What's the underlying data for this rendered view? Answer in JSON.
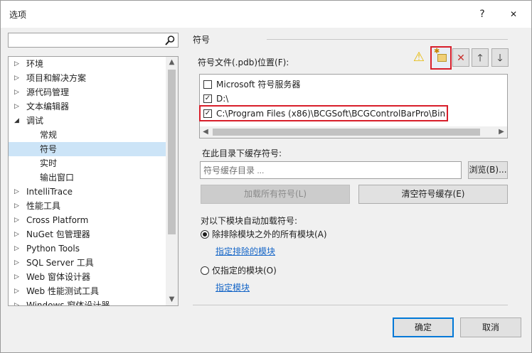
{
  "window": {
    "title": "选项",
    "help": "?",
    "close": "✕"
  },
  "search": {
    "value": "",
    "placeholder": ""
  },
  "tree": {
    "items": [
      {
        "label": "环境",
        "arrow": "▷"
      },
      {
        "label": "项目和解决方案",
        "arrow": "▷"
      },
      {
        "label": "源代码管理",
        "arrow": "▷"
      },
      {
        "label": "文本编辑器",
        "arrow": "▷"
      },
      {
        "label": "调试",
        "arrow": "◢"
      },
      {
        "label": "常规",
        "arrow": ""
      },
      {
        "label": "符号",
        "arrow": ""
      },
      {
        "label": "实时",
        "arrow": ""
      },
      {
        "label": "输出窗口",
        "arrow": ""
      },
      {
        "label": "IntelliTrace",
        "arrow": "▷"
      },
      {
        "label": "性能工具",
        "arrow": "▷"
      },
      {
        "label": "Cross Platform",
        "arrow": "▷"
      },
      {
        "label": "NuGet 包管理器",
        "arrow": "▷"
      },
      {
        "label": "Python Tools",
        "arrow": "▷"
      },
      {
        "label": "SQL Server 工具",
        "arrow": "▷"
      },
      {
        "label": "Web 窗体设计器",
        "arrow": "▷"
      },
      {
        "label": "Web 性能测试工具",
        "arrow": "▷"
      },
      {
        "label": "Windows 窗体设计器",
        "arrow": "▷"
      }
    ]
  },
  "symbols": {
    "section_title": "符号",
    "pdb_label": "符号文件(.pdb)位置(F):",
    "locations": [
      {
        "text": "Microsoft 符号服务器",
        "checked": ""
      },
      {
        "text": "D:\\",
        "checked": "✓"
      },
      {
        "text": "C:\\Program Files (x86)\\BCGSoft\\BCGControlBarPro\\Bin",
        "checked": "✓"
      }
    ],
    "cache_label": "在此目录下缓存符号:",
    "cache_placeholder": "符号缓存目录 ...",
    "browse_button": "浏览(B)...",
    "load_all_button": "加载所有符号(L)",
    "clear_cache_button": "清空符号缓存(E)",
    "auto_load_label": "对以下模块自动加载符号:",
    "option_all_except": "除排除模块之外的所有模块(A)",
    "link_exclude": "指定排除的模块",
    "option_only": "仅指定的模块(O)",
    "link_specify": "指定模块"
  },
  "footer": {
    "ok": "确定",
    "cancel": "取消"
  }
}
